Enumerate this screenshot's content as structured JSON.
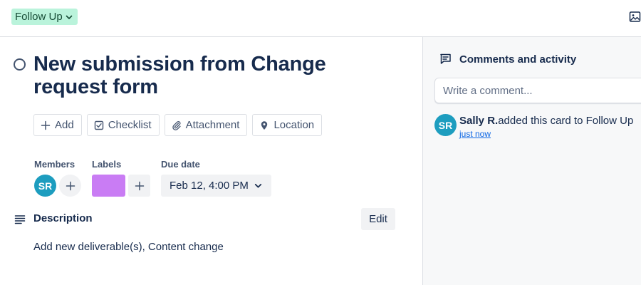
{
  "header": {
    "list_name": "Follow Up",
    "list_pill_color": "#baf3db",
    "cover_icon": "image-icon"
  },
  "card": {
    "title": "New submission from Change request form",
    "actions": [
      {
        "label": "Add",
        "icon": "plus-icon"
      },
      {
        "label": "Checklist",
        "icon": "checkbox-icon"
      },
      {
        "label": "Attachment",
        "icon": "paperclip-icon"
      },
      {
        "label": "Location",
        "icon": "location-pin-icon"
      }
    ],
    "members": {
      "label": "Members",
      "items": [
        {
          "initials": "SR",
          "color": "#1d9dbf"
        }
      ]
    },
    "labels": {
      "label": "Labels",
      "items": [
        {
          "color": "#c97cf4"
        }
      ]
    },
    "due_date": {
      "label": "Due date",
      "value": "Feb 12, 4:00 PM"
    },
    "description": {
      "heading": "Description",
      "edit_label": "Edit",
      "text": "Add new deliverable(s), Content change"
    }
  },
  "sidebar": {
    "heading": "Comments and activity",
    "comment_placeholder": "Write a comment...",
    "activity": [
      {
        "initials": "SR",
        "user": "Sally R.",
        "action": "added this card to Follow Up",
        "time": "just now"
      }
    ]
  }
}
